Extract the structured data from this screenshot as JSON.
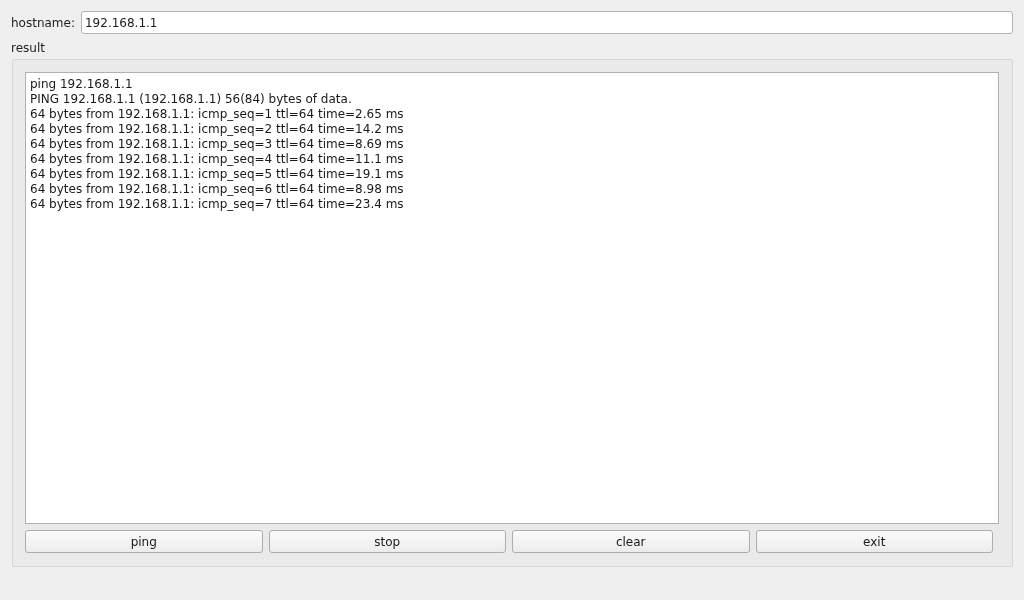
{
  "hostname": {
    "label": "hostname:",
    "value": "192.168.1.1"
  },
  "result": {
    "label": "result",
    "output_lines": [
      "ping 192.168.1.1",
      "PING 192.168.1.1 (192.168.1.1) 56(84) bytes of data.",
      "64 bytes from 192.168.1.1: icmp_seq=1 ttl=64 time=2.65 ms",
      "64 bytes from 192.168.1.1: icmp_seq=2 ttl=64 time=14.2 ms",
      "64 bytes from 192.168.1.1: icmp_seq=3 ttl=64 time=8.69 ms",
      "64 bytes from 192.168.1.1: icmp_seq=4 ttl=64 time=11.1 ms",
      "64 bytes from 192.168.1.1: icmp_seq=5 ttl=64 time=19.1 ms",
      "64 bytes from 192.168.1.1: icmp_seq=6 ttl=64 time=8.98 ms",
      "64 bytes from 192.168.1.1: icmp_seq=7 ttl=64 time=23.4 ms"
    ]
  },
  "buttons": [
    "ping",
    "stop",
    "clear",
    "exit"
  ]
}
